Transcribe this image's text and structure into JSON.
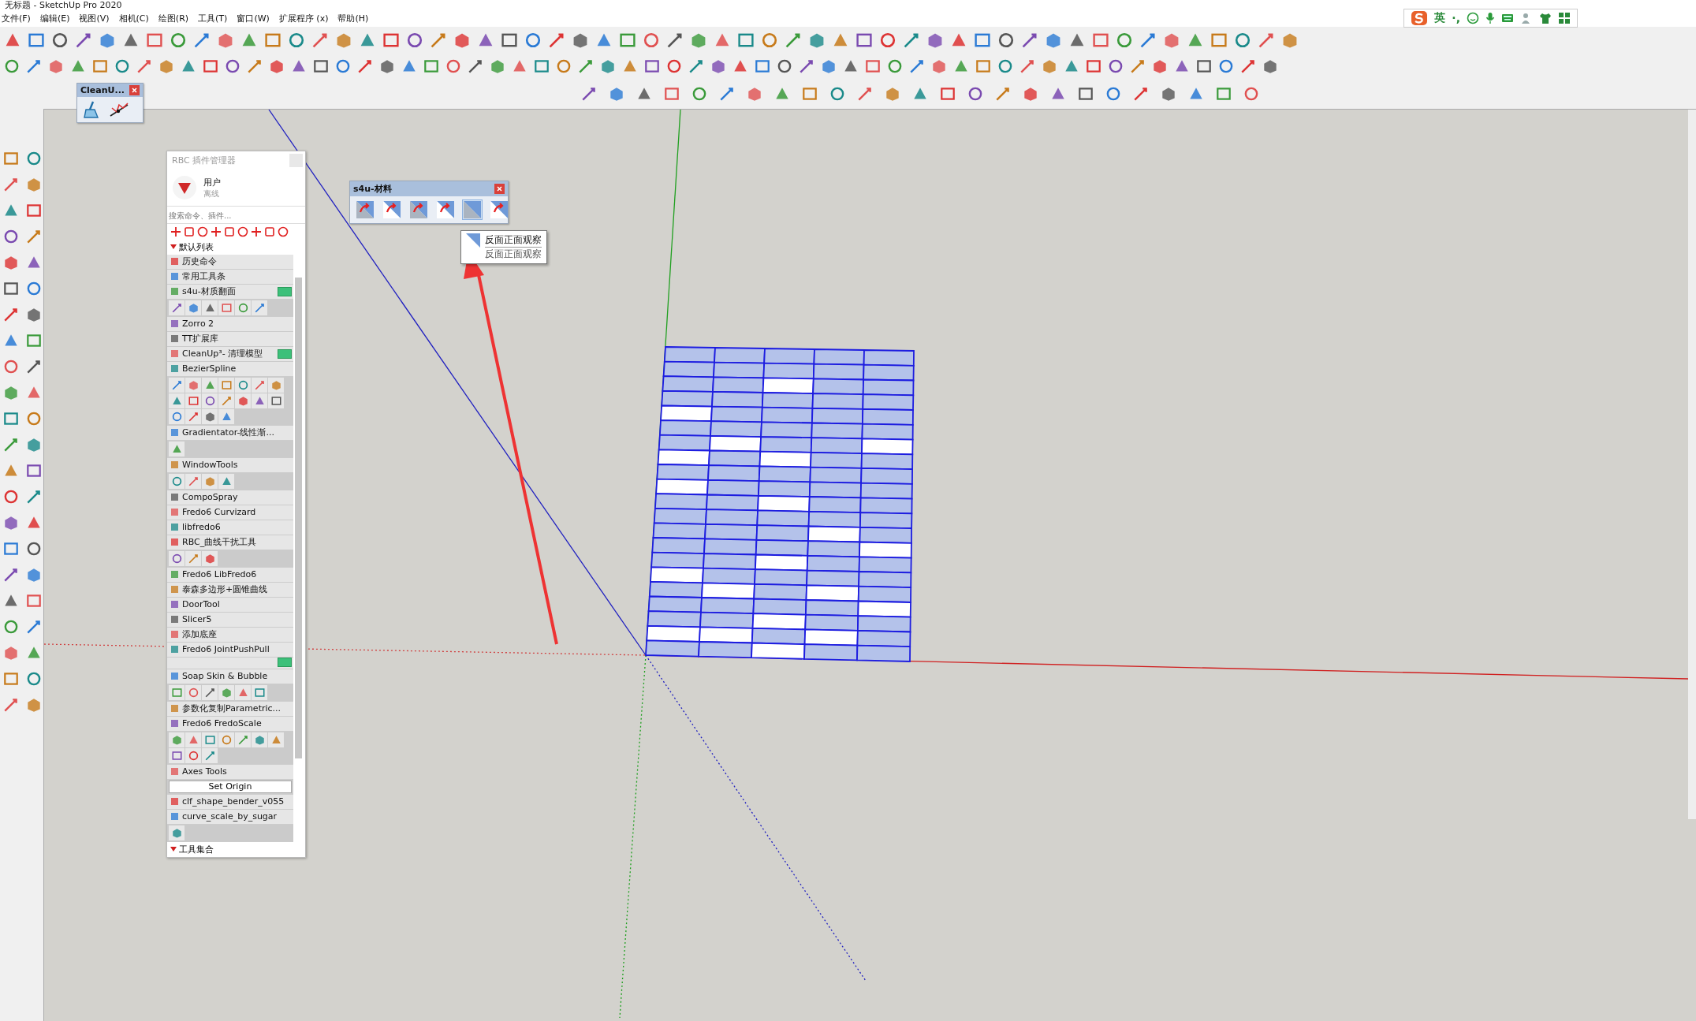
{
  "window": {
    "title": "无标题 - SketchUp Pro 2020"
  },
  "menu": [
    "文件(F)",
    "编辑(E)",
    "视图(V)",
    "相机(C)",
    "绘图(R)",
    "工具(T)",
    "窗口(W)",
    "扩展程序 (x)",
    "帮助(H)"
  ],
  "ime_bar": {
    "language": "英",
    "punctuation": "·,"
  },
  "cleanup_toolbar": {
    "title": "CleanU..."
  },
  "s4u_toolbar": {
    "title": "s4u-材料",
    "buttons": [
      {
        "selected": false
      },
      {
        "selected": false
      },
      {
        "selected": false
      },
      {
        "selected": false
      },
      {
        "selected": true
      },
      {
        "selected": false
      }
    ]
  },
  "tooltip": {
    "title": "反面正面观察",
    "description": "反面正面观察"
  },
  "plugin_manager": {
    "title": "RBC 插件管理器",
    "user": "用户",
    "status": "离线",
    "search": {
      "placeholder": "搜索命令、插件..."
    },
    "section": "默认列表",
    "footer_section": "工具集合",
    "items": [
      {
        "kind": "plugin",
        "name": "历史命令"
      },
      {
        "kind": "plugin",
        "name": "常用工具条"
      },
      {
        "kind": "plugin-switch",
        "name": "s4u-材质翻面",
        "on": true
      },
      {
        "kind": "icons"
      },
      {
        "kind": "plugin",
        "name": "Zorro 2"
      },
      {
        "kind": "plugin",
        "name": "TT扩展库"
      },
      {
        "kind": "plugin-switch",
        "name": "CleanUp³- 清理模型",
        "on": true
      },
      {
        "kind": "plugin",
        "name": "BezierSpline"
      },
      {
        "kind": "icons"
      },
      {
        "kind": "plugin",
        "name": "Gradientator-线性渐..."
      },
      {
        "kind": "icons"
      },
      {
        "kind": "plugin",
        "name": "WindowTools"
      },
      {
        "kind": "icons"
      },
      {
        "kind": "plugin",
        "name": "CompoSpray"
      },
      {
        "kind": "plugin",
        "name": "Fredo6 Curvizard"
      },
      {
        "kind": "plugin",
        "name": "libfredo6"
      },
      {
        "kind": "plugin",
        "name": "RBC_曲线干扰工具"
      },
      {
        "kind": "icons"
      },
      {
        "kind": "plugin",
        "name": "Fredo6 LibFredo6"
      },
      {
        "kind": "plugin",
        "name": "泰森多边形+圆锥曲线"
      },
      {
        "kind": "plugin",
        "name": "DoorTool"
      },
      {
        "kind": "plugin",
        "name": "Slicer5"
      },
      {
        "kind": "plugin",
        "name": "添加底座"
      },
      {
        "kind": "plugin",
        "name": "Fredo6 JointPushPull"
      },
      {
        "kind": "switch",
        "on": true
      },
      {
        "kind": "plugin",
        "name": "Soap Skin & Bubble"
      },
      {
        "kind": "icons"
      },
      {
        "kind": "plugin",
        "name": "参数化复制Parametric..."
      },
      {
        "kind": "plugin",
        "name": "Fredo6 FredoScale"
      },
      {
        "kind": "icons"
      },
      {
        "kind": "plugin",
        "name": "Axes Tools"
      },
      {
        "kind": "button",
        "label": "Set Origin"
      },
      {
        "kind": "plugin",
        "name": "clf_shape_bender_v055"
      },
      {
        "kind": "plugin",
        "name": "curve_scale_by_sugar"
      },
      {
        "kind": "icons"
      }
    ]
  }
}
